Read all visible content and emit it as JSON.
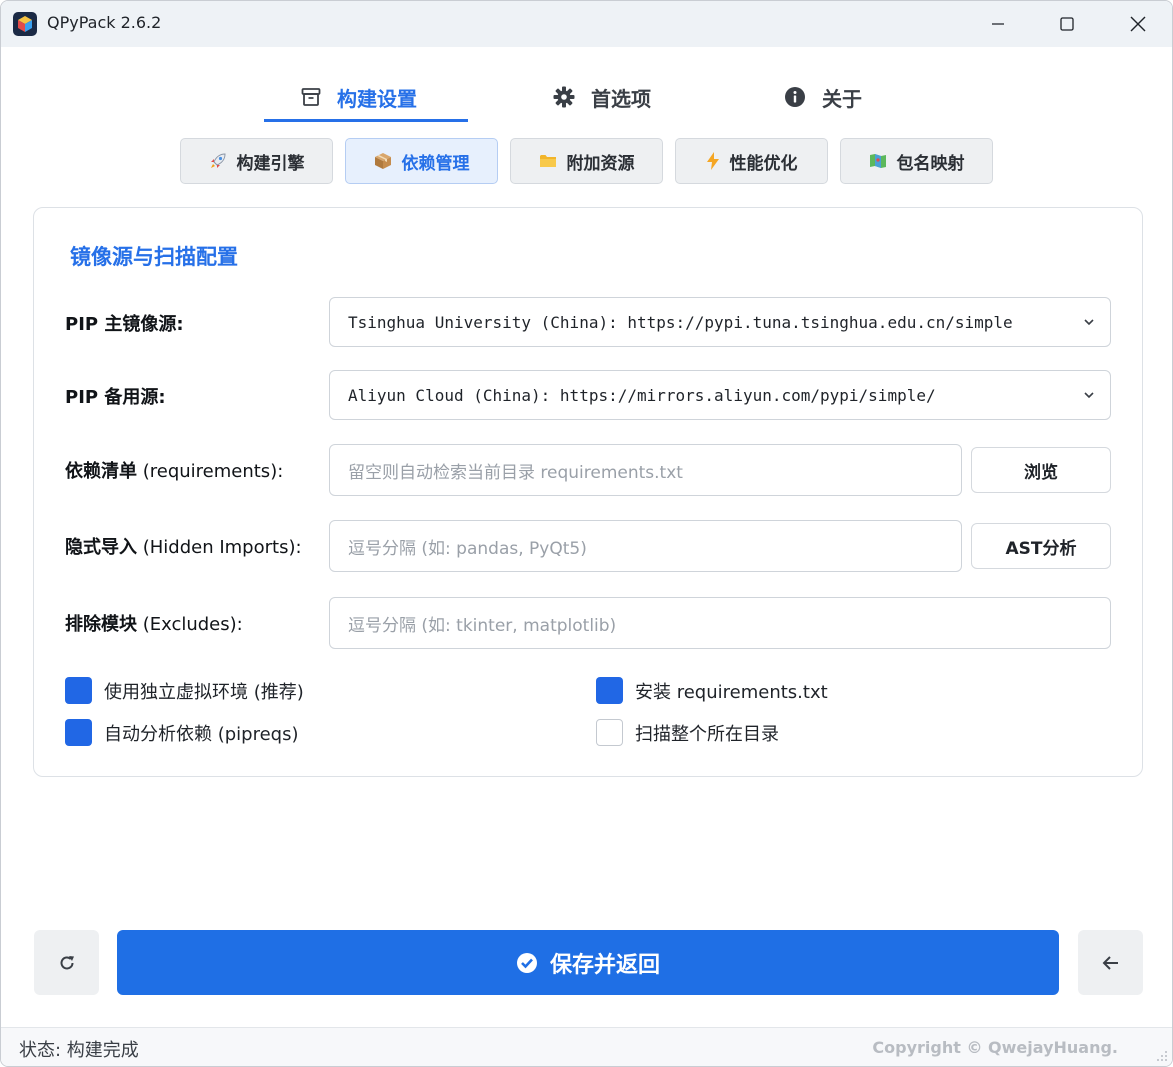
{
  "window": {
    "title": "QPyPack 2.6.2"
  },
  "main_tabs": [
    {
      "label": "构建设置",
      "icon": "archive-icon",
      "active": true
    },
    {
      "label": "首选项",
      "icon": "gear-icon",
      "active": false
    },
    {
      "label": "关于",
      "icon": "info-icon",
      "active": false
    }
  ],
  "sub_tabs": [
    {
      "label": "构建引擎",
      "icon": "rocket-icon"
    },
    {
      "label": "依赖管理",
      "icon": "package-icon",
      "active": true
    },
    {
      "label": "附加资源",
      "icon": "folder-icon"
    },
    {
      "label": "性能优化",
      "icon": "lightning-icon"
    },
    {
      "label": "包名映射",
      "icon": "map-icon"
    }
  ],
  "section": {
    "title": "镜像源与扫描配置",
    "pip_main": {
      "label_bold": "PIP 主镜像源:",
      "value": "Tsinghua University (China): https://pypi.tuna.tsinghua.edu.cn/simple"
    },
    "pip_backup": {
      "label_bold": "PIP 备用源:",
      "value": "Aliyun Cloud (China): https://mirrors.aliyun.com/pypi/simple/"
    },
    "requirements": {
      "label_bold": "依赖清单",
      "label_rest": " (requirements):",
      "placeholder": "留空则自动检索当前目录 requirements.txt",
      "button": "浏览"
    },
    "hidden_imports": {
      "label_bold": "隐式导入",
      "label_rest": " (Hidden Imports):",
      "placeholder": "逗号分隔 (如: pandas, PyQt5)",
      "button": "AST分析"
    },
    "excludes": {
      "label_bold": "排除模块",
      "label_rest": " (Excludes):",
      "placeholder": "逗号分隔 (如: tkinter, matplotlib)"
    },
    "checkboxes": [
      {
        "label": "使用独立虚拟环境 (推荐)",
        "checked": true
      },
      {
        "label": "安装 requirements.txt",
        "checked": true
      },
      {
        "label": "自动分析依赖 (pipreqs)",
        "checked": true
      },
      {
        "label": "扫描整个所在目录",
        "checked": false
      }
    ]
  },
  "actions": {
    "save_label": "保存并返回"
  },
  "status": {
    "text": "状态: 构建完成",
    "copyright": "Copyright © QwejayHuang."
  },
  "colors": {
    "accent": "#2670e8",
    "primary_button": "#1f6fe5",
    "checkbox_on": "#2167e5"
  }
}
